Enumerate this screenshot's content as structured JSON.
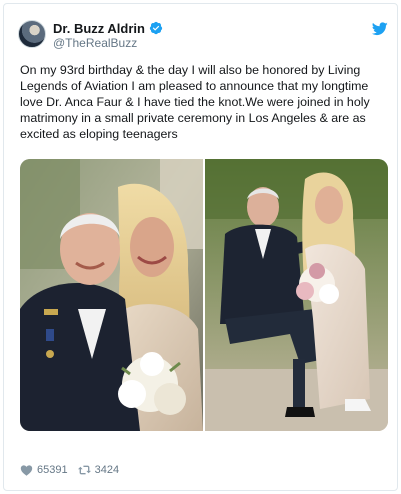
{
  "tweet": {
    "author": {
      "display_name": "Dr. Buzz Aldrin",
      "handle": "@TheRealBuzz",
      "verified": true,
      "avatar_icon": "avatar"
    },
    "brand_icon": "twitter-bird-icon",
    "text": "On my 93rd birthday & the day I will also be honored by Living Legends of Aviation I am pleased to announce that my longtime love Dr. Anca Faur & I have tied the knot.We were joined in holy matrimony in a small private ceremony in Los Angeles & are as excited as eloping teenagers",
    "media": [
      {
        "kind": "photo",
        "name": "wedding-photo-couple-portrait"
      },
      {
        "kind": "photo",
        "name": "wedding-photo-toast"
      }
    ],
    "stats": {
      "likes": "65391",
      "retweets": "3424",
      "like_icon": "heart-icon",
      "retweet_icon": "retweet-icon"
    }
  },
  "colors": {
    "brand_blue": "#1da1f2",
    "text_primary": "#14171a",
    "text_secondary": "#657786",
    "border": "#e1e8ed"
  }
}
